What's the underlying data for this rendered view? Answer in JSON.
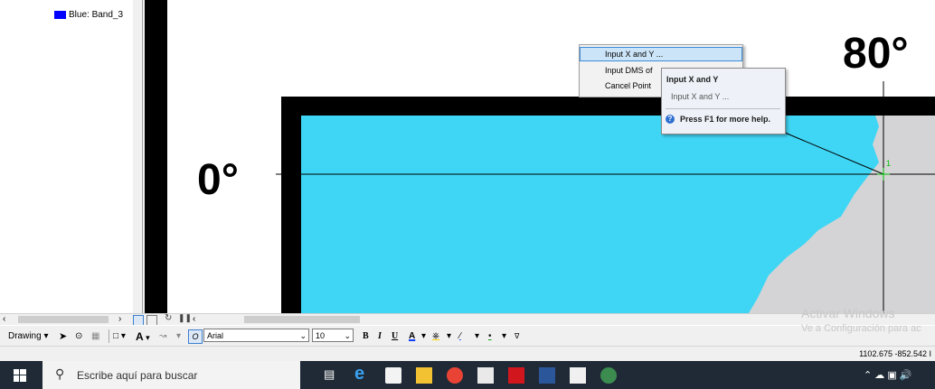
{
  "toc": {
    "legend_label": "Blue:  Band_3",
    "legend_color": "#0000ff"
  },
  "map": {
    "label_left": "0°",
    "label_top": "80°",
    "point_label": "1",
    "water_color": "#3fd6f5",
    "land_color": "#d4d4d6"
  },
  "context_menu": {
    "items": [
      "Input X and Y ...",
      "Input DMS of",
      "Cancel Point"
    ]
  },
  "tooltip": {
    "title": "Input X and Y",
    "body": "Input X and Y ...",
    "help": "Press F1 for more help."
  },
  "drawing_toolbar": {
    "drawing_label": "Drawing",
    "font_name": "Arial",
    "font_size": "10",
    "bold": "B",
    "italic": "I",
    "underline": "U",
    "font_color_letter": "A",
    "text_tool_letter": "A"
  },
  "status": {
    "coordinates": "1102.675  -852.542 I"
  },
  "watermark": {
    "line1": "Activar Windows",
    "line2": "Ve a Configuración para ac"
  },
  "taskbar": {
    "search_placeholder": "Escribe aquí para buscar"
  }
}
